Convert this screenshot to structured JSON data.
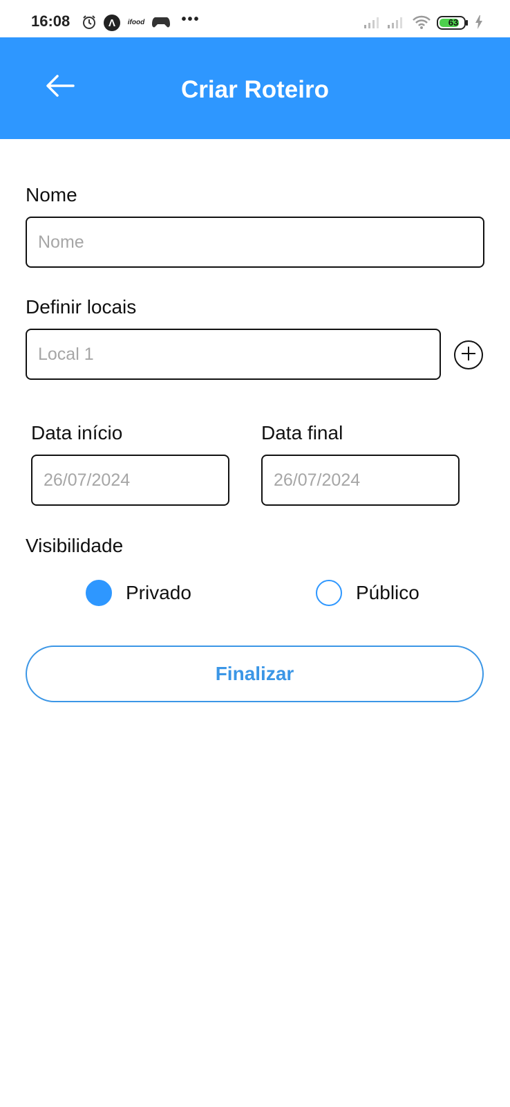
{
  "status_bar": {
    "time": "16:08",
    "icons": [
      "alarm-icon",
      "app-a-icon",
      "ifood-icon",
      "gamepad-icon",
      "more-icon",
      "signal-icon",
      "signal-icon",
      "wifi-icon",
      "battery-icon",
      "charging-icon"
    ],
    "app_a_letter": "Λ",
    "ifood_text": "ifood",
    "more_text": "•••",
    "battery_level": "63"
  },
  "header": {
    "title": "Criar Roteiro",
    "back_icon": "arrow-left-icon"
  },
  "form": {
    "name_label": "Nome",
    "name_placeholder": "Nome",
    "name_value": "",
    "places_label": "Definir locais",
    "place1_placeholder": "Local 1",
    "place1_value": "",
    "add_place_icon": "plus-circle-icon",
    "start_date_label": "Data início",
    "start_date_placeholder": "26/07/2024",
    "end_date_label": "Data final",
    "end_date_placeholder": "26/07/2024",
    "visibility_label": "Visibilidade",
    "visibility_options": [
      {
        "label": "Privado",
        "selected": true
      },
      {
        "label": "Público",
        "selected": false
      }
    ],
    "submit_label": "Finalizar"
  },
  "colors": {
    "primary": "#2e97ff",
    "button_text": "#3b96e6",
    "placeholder": "#a6a6a6"
  }
}
